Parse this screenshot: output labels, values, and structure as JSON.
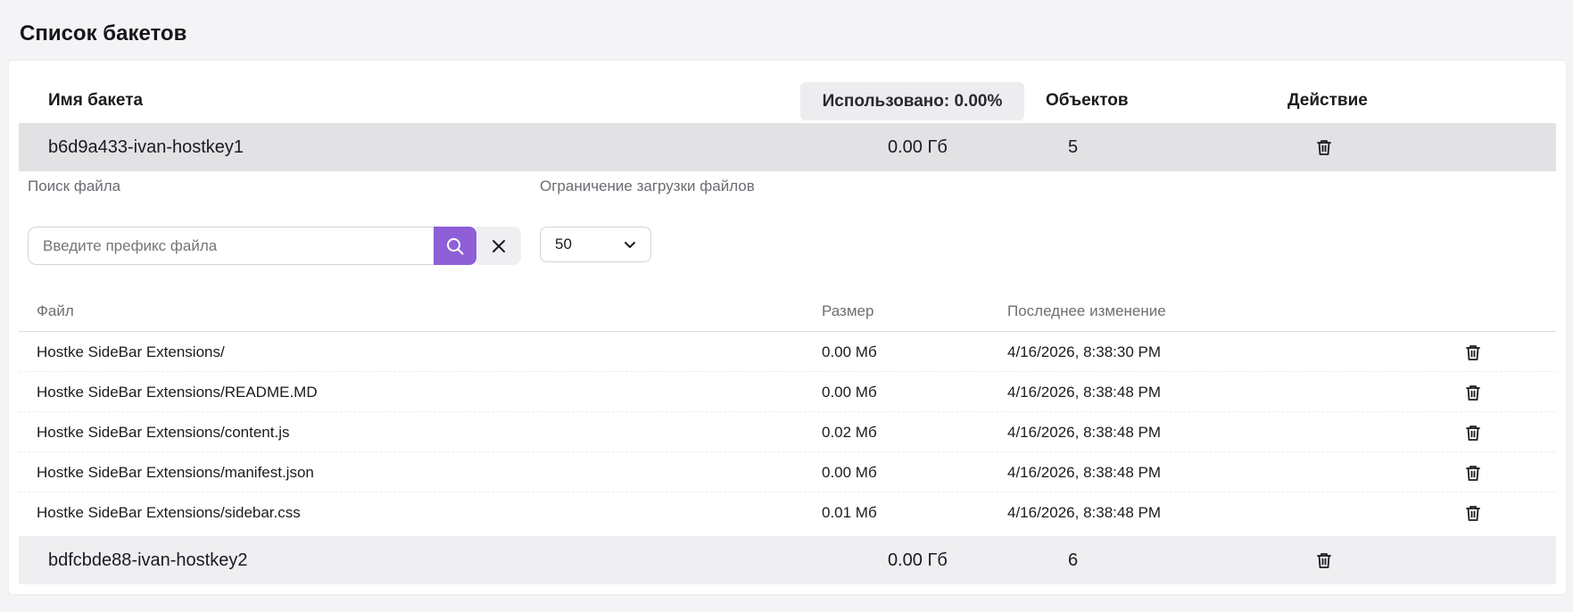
{
  "page": {
    "title": "Список бакетов"
  },
  "bucket_table": {
    "columns": {
      "name": "Имя бакета",
      "used": "Использовано: 0.00%",
      "objects": "Объектов",
      "action": "Действие"
    },
    "buckets": [
      {
        "name": "b6d9a433-ivan-hostkey1",
        "size": "0.00 Гб",
        "objects": "5"
      },
      {
        "name": "bdfcbde88-ivan-hostkey2",
        "size": "0.00 Гб",
        "objects": "6"
      }
    ]
  },
  "file_browser": {
    "search_label": "Поиск файла",
    "search_placeholder": "Введите префикс файла",
    "limit_label": "Ограничение загрузки файлов",
    "limit_value": "50",
    "columns": {
      "file": "Файл",
      "size": "Размер",
      "modified": "Последнее изменение"
    },
    "files": [
      {
        "name": "Hostke SideBar Extensions/",
        "size": "0.00 Мб",
        "modified": "4/16/2026, 8:38:30 PM"
      },
      {
        "name": "Hostke SideBar Extensions/README.MD",
        "size": "0.00 Мб",
        "modified": "4/16/2026, 8:38:48 PM"
      },
      {
        "name": "Hostke SideBar Extensions/content.js",
        "size": "0.02 Мб",
        "modified": "4/16/2026, 8:38:48 PM"
      },
      {
        "name": "Hostke SideBar Extensions/manifest.json",
        "size": "0.00 Мб",
        "modified": "4/16/2026, 8:38:48 PM"
      },
      {
        "name": "Hostke SideBar Extensions/sidebar.css",
        "size": "0.01 Мб",
        "modified": "4/16/2026, 8:38:48 PM"
      }
    ]
  },
  "colors": {
    "accent": "#8e5fd6",
    "selected_row": "#e2e2e4",
    "alt_row": "#efeff1"
  },
  "icons": {
    "delete": "trash-icon",
    "search": "search-icon",
    "clear": "close-icon",
    "dropdown": "chevron-down-icon"
  }
}
